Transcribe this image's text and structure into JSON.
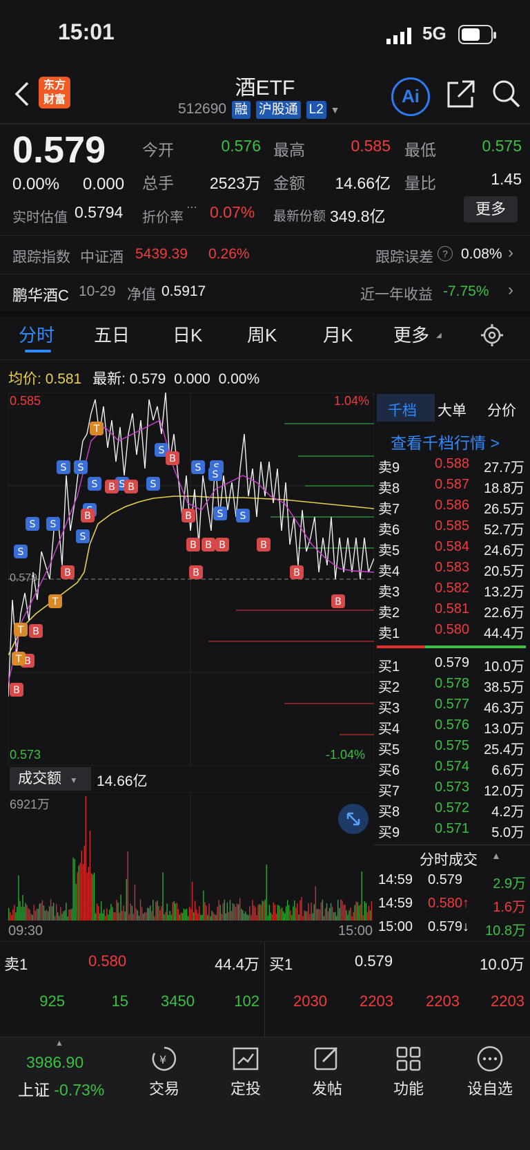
{
  "status_bar": {
    "time": "15:01",
    "network": "5G"
  },
  "header": {
    "logo_text": "东方财富",
    "title": "酒ETF",
    "code": "512690",
    "tags": [
      "融",
      "沪股通",
      "L2"
    ],
    "ai_label": "Ai"
  },
  "quote": {
    "price": "0.579",
    "change_pct": "0.00%",
    "change": "0.000",
    "rows": [
      {
        "k1": "今开",
        "v1": "0.576",
        "k2": "最高",
        "v2": "0.585",
        "k3": "最低",
        "v3": "0.575"
      },
      {
        "k1": "总手",
        "v1": "2523万",
        "k2": "金额",
        "v2": "14.66亿",
        "k3": "量比",
        "v3": "1.45"
      }
    ],
    "est_label": "实时估值",
    "est_value": "0.5794",
    "premium_label": "折价率",
    "premium_value": "0.07%",
    "share_label": "最新份额",
    "share_value": "349.8亿",
    "more_label": "更多"
  },
  "tracking": {
    "label": "跟踪指数",
    "index_name": "中证酒",
    "index_value": "5439.39",
    "index_change": "0.26%",
    "error_label": "跟踪误差",
    "error_value": "0.08%"
  },
  "fund_link": {
    "name": "鹏华酒C",
    "date": "10-29",
    "nav_label": "净值",
    "nav_value": "0.5917",
    "return_label": "近一年收益",
    "return_value": "-7.75%"
  },
  "chart_tabs": [
    "分时",
    "五日",
    "日K",
    "周K",
    "月K",
    "更多"
  ],
  "chart_info": {
    "avg_label": "均价:",
    "avg_value": "0.581",
    "latest_label": "最新:",
    "latest_value": "0.579",
    "latest_change": "0.000",
    "latest_pct": "0.00%"
  },
  "chart_axis": {
    "top_price": "0.585",
    "top_pct": "1.04%",
    "bottom_price": "0.573",
    "bottom_pct": "-1.04%",
    "mid_price": "0.579",
    "time_start": "09:30",
    "time_end": "15:00"
  },
  "volume": {
    "label": "成交额",
    "total": "14.66亿",
    "max_label": "6921万"
  },
  "side_tabs": [
    "千档",
    "大单",
    "分价"
  ],
  "side_link": "查看千档行情 >",
  "asks": [
    {
      "label": "卖9",
      "price": "0.588",
      "vol": "27.7万"
    },
    {
      "label": "卖8",
      "price": "0.587",
      "vol": "18.8万"
    },
    {
      "label": "卖7",
      "price": "0.586",
      "vol": "26.5万"
    },
    {
      "label": "卖6",
      "price": "0.585",
      "vol": "52.7万"
    },
    {
      "label": "卖5",
      "price": "0.584",
      "vol": "24.6万"
    },
    {
      "label": "卖4",
      "price": "0.583",
      "vol": "20.5万"
    },
    {
      "label": "卖3",
      "price": "0.582",
      "vol": "13.2万"
    },
    {
      "label": "卖2",
      "price": "0.581",
      "vol": "22.6万"
    },
    {
      "label": "卖1",
      "price": "0.580",
      "vol": "44.4万"
    }
  ],
  "bids": [
    {
      "label": "买1",
      "price": "0.579",
      "vol": "10.0万"
    },
    {
      "label": "买2",
      "price": "0.578",
      "vol": "38.5万"
    },
    {
      "label": "买3",
      "price": "0.577",
      "vol": "46.3万"
    },
    {
      "label": "买4",
      "price": "0.576",
      "vol": "13.0万"
    },
    {
      "label": "买5",
      "price": "0.575",
      "vol": "25.4万"
    },
    {
      "label": "买6",
      "price": "0.574",
      "vol": "6.6万"
    },
    {
      "label": "买7",
      "price": "0.573",
      "vol": "12.0万"
    },
    {
      "label": "买8",
      "price": "0.572",
      "vol": "4.2万"
    },
    {
      "label": "买9",
      "price": "0.571",
      "vol": "5.0万"
    }
  ],
  "ticks_header": "分时成交",
  "ticks": [
    {
      "time": "14:59",
      "price": "0.579",
      "vol": "2.9万"
    },
    {
      "time": "14:59",
      "price": "0.580↑",
      "vol": "1.6万"
    },
    {
      "time": "15:00",
      "price": "0.579↓",
      "vol": "10.8万"
    }
  ],
  "book_summary": {
    "ask_label": "卖1",
    "ask_price": "0.580",
    "ask_vol": "44.4万",
    "bid_label": "买1",
    "bid_price": "0.579",
    "bid_vol": "10.0万",
    "ask_orders": [
      "925",
      "15",
      "3450",
      "102"
    ],
    "bid_orders": [
      "2030",
      "2203",
      "2203",
      "2203"
    ]
  },
  "bottom_nav": {
    "index_value": "3986.90",
    "index_name": "上证",
    "index_change": "-0.73%",
    "items": [
      "交易",
      "定投",
      "发帖",
      "功能",
      "设自选"
    ]
  }
}
